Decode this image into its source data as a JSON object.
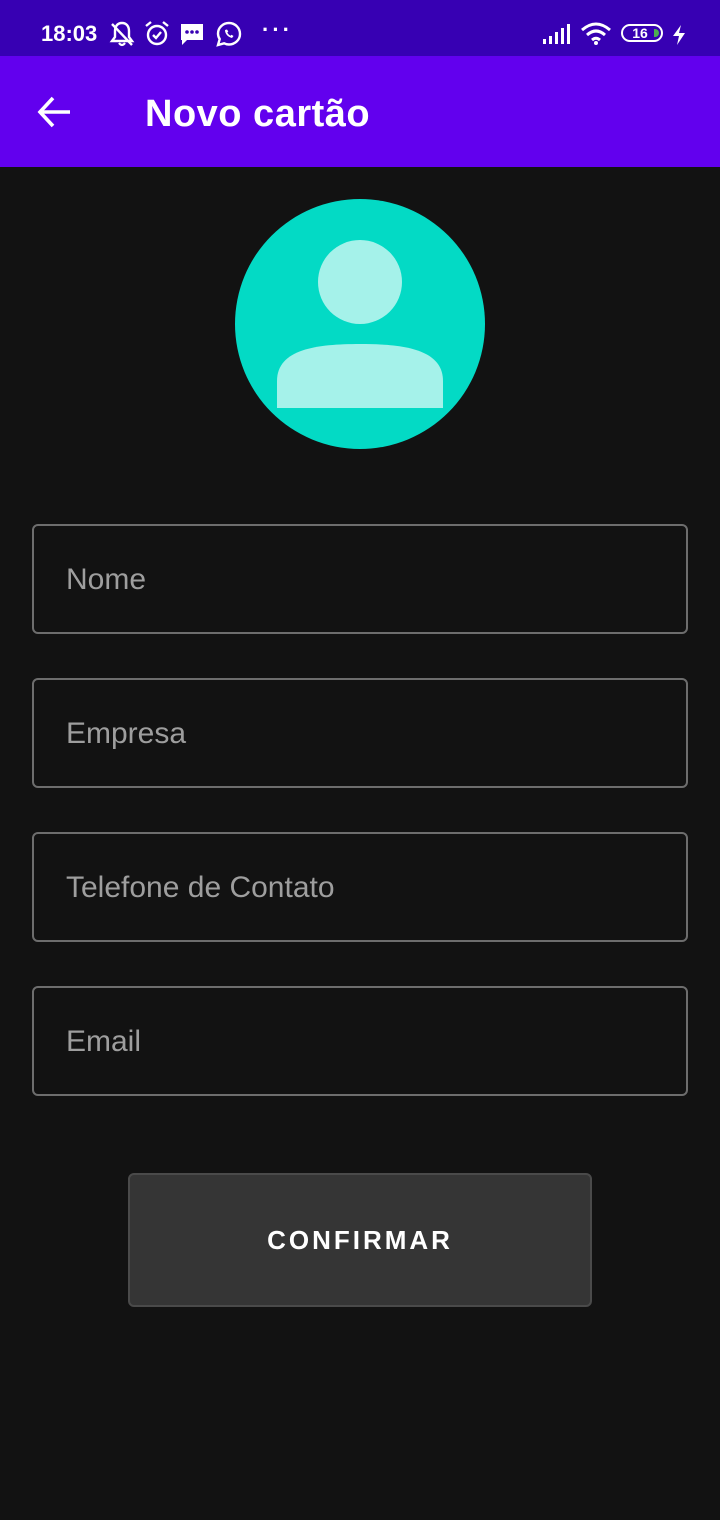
{
  "status_bar": {
    "time": "18:03",
    "icons": [
      "notifications-off-icon",
      "alarm-icon",
      "message-icon",
      "whatsapp-icon",
      "more-dots-icon",
      "signal-icon",
      "wifi-icon",
      "battery-icon",
      "charging-icon"
    ],
    "overflow_dots": "···",
    "battery_level": "16",
    "background_color": "#3700b3"
  },
  "app_bar": {
    "back_icon": "arrow-back-icon",
    "title": "Novo cartão",
    "background_color": "#6200ee"
  },
  "avatar": {
    "icon": "person-icon",
    "background_color": "#03dac5"
  },
  "form": {
    "nome": {
      "placeholder": "Nome",
      "value": ""
    },
    "empresa": {
      "placeholder": "Empresa",
      "value": ""
    },
    "telefone": {
      "placeholder": "Telefone de Contato",
      "value": ""
    },
    "email": {
      "placeholder": "Email",
      "value": ""
    }
  },
  "confirm_button": {
    "label": "CONFIRMAR"
  }
}
